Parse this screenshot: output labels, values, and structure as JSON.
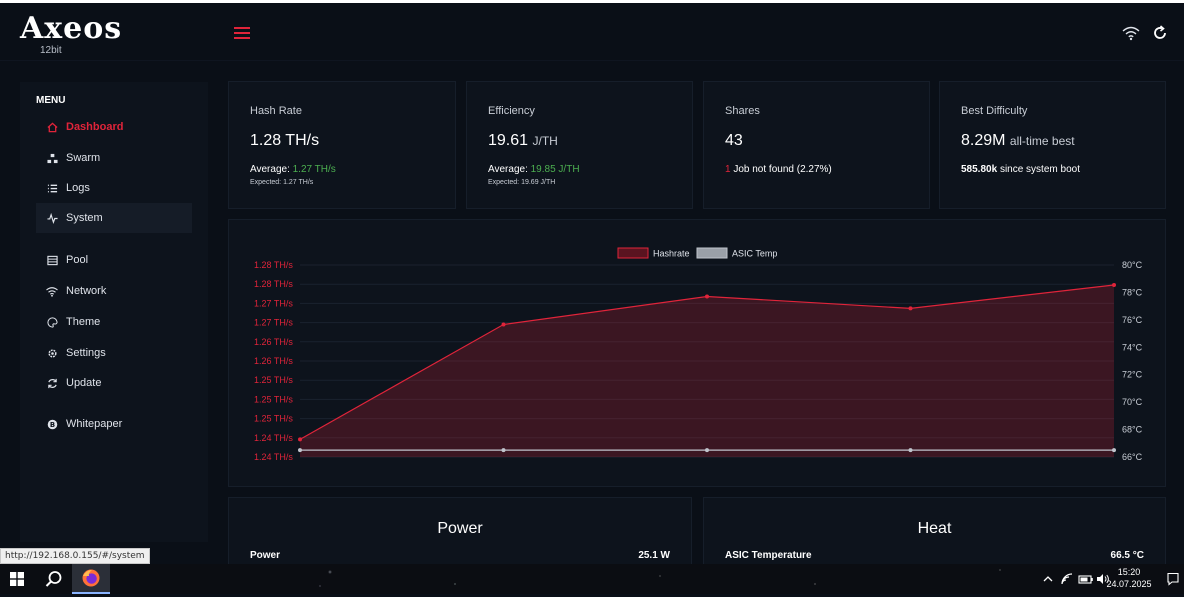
{
  "header": {
    "logo": "Axeos",
    "logo_sub": "12bit"
  },
  "sidebar": {
    "menu_title": "MENU",
    "items": [
      {
        "label": "Dashboard",
        "icon": "home-icon",
        "active": true
      },
      {
        "label": "Swarm",
        "icon": "swarm-icon"
      },
      {
        "label": "Logs",
        "icon": "list-icon"
      },
      {
        "label": "System",
        "icon": "pulse-icon",
        "hover": true
      },
      {
        "label": "Pool",
        "icon": "server-icon"
      },
      {
        "label": "Network",
        "icon": "wifi-icon"
      },
      {
        "label": "Theme",
        "icon": "palette-icon"
      },
      {
        "label": "Settings",
        "icon": "gear-icon"
      },
      {
        "label": "Update",
        "icon": "refresh-icon"
      },
      {
        "label": "Whitepaper",
        "icon": "bitcoin-icon"
      }
    ]
  },
  "cards": {
    "hashrate": {
      "title": "Hash Rate",
      "value": "1.28 TH/s",
      "avg_label": "Average:",
      "avg_value": "1.27 TH/s",
      "expected": "Expected: 1.27 TH/s"
    },
    "efficiency": {
      "title": "Efficiency",
      "value": "19.61",
      "unit": "J/TH",
      "avg_label": "Average:",
      "avg_value": "19.85 J/TH",
      "expected": "Expected: 19.69 J/TH"
    },
    "shares": {
      "title": "Shares",
      "value": "43",
      "reject_count": "1",
      "reject_text": "Job not found",
      "reject_pct": "(2.27%)"
    },
    "difficulty": {
      "title": "Best Difficulty",
      "value": "8.29M",
      "value_suffix": "all-time best",
      "boot_value": "585.80k",
      "boot_text": "since system boot"
    }
  },
  "chart_data": {
    "type": "line",
    "legend": [
      "Hashrate",
      "ASIC Temp"
    ],
    "legend_position": "top-center",
    "x": [
      1,
      2,
      3,
      4,
      5
    ],
    "series": [
      {
        "name": "Hashrate",
        "axis": "left",
        "values": [
          1.2406,
          1.2705,
          1.2778,
          1.2747,
          1.2808
        ],
        "color": "#e0243a",
        "fill": true
      },
      {
        "name": "ASIC Temp",
        "axis": "right",
        "values": [
          66.5,
          66.5,
          66.5,
          66.5,
          66.5
        ],
        "color": "#c0c4cc"
      }
    ],
    "y_left_ticks": [
      "1.28 TH/s",
      "1.28 TH/s",
      "1.27 TH/s",
      "1.27 TH/s",
      "1.26 TH/s",
      "1.26 TH/s",
      "1.25 TH/s",
      "1.25 TH/s",
      "1.25 TH/s",
      "1.24 TH/s",
      "1.24 TH/s"
    ],
    "y_left_range": [
      1.236,
      1.286
    ],
    "y_right_ticks": [
      "80°C",
      "78°C",
      "76°C",
      "74°C",
      "72°C",
      "70°C",
      "68°C",
      "66°C"
    ],
    "y_right_range": [
      66,
      80
    ],
    "grid": true
  },
  "power": {
    "title": "Power",
    "label": "Power",
    "value": "25.1 W"
  },
  "heat": {
    "title": "Heat",
    "label": "ASIC Temperature",
    "value": "66.5 °C"
  },
  "statusbar": {
    "url": "http://192.168.0.155/#/system"
  },
  "taskbar": {
    "time": "15:20",
    "date": "24.07.2025"
  },
  "colors": {
    "accent": "#e0243a",
    "positive": "#4caf50",
    "background": "#0a0f17",
    "card": "#0d131c"
  }
}
